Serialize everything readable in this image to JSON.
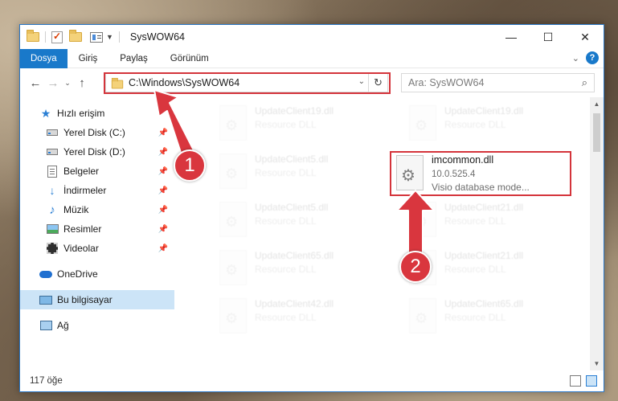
{
  "window": {
    "title": "SysWOW64",
    "controls": {
      "minimize": "—",
      "maximize": "☐",
      "close": "✕"
    }
  },
  "ribbon": {
    "tabs": [
      {
        "label": "Dosya",
        "active": true
      },
      {
        "label": "Giriş"
      },
      {
        "label": "Paylaş"
      },
      {
        "label": "Görünüm"
      }
    ],
    "help": "?"
  },
  "nav": {
    "back": "←",
    "forward": "→",
    "recent": "⌄",
    "up": "↑",
    "address": "C:\\Windows\\SysWOW64",
    "search_placeholder": "Ara: SysWOW64"
  },
  "sidebar": {
    "items": [
      {
        "label": "Hızlı erişim",
        "icon": "star-icon"
      },
      {
        "label": "Yerel Disk (C:)",
        "icon": "drive-icon",
        "pinned": true
      },
      {
        "label": "Yerel Disk (D:)",
        "icon": "drive-icon",
        "pinned": true
      },
      {
        "label": "Belgeler",
        "icon": "document-icon",
        "pinned": true
      },
      {
        "label": "İndirmeler",
        "icon": "download-icon",
        "pinned": true
      },
      {
        "label": "Müzik",
        "icon": "music-icon",
        "pinned": true
      },
      {
        "label": "Resimler",
        "icon": "pictures-icon",
        "pinned": true
      },
      {
        "label": "Videolar",
        "icon": "video-icon",
        "pinned": true
      },
      {
        "label": "OneDrive",
        "icon": "cloud-icon"
      },
      {
        "label": "Bu bilgisayar",
        "icon": "computer-icon",
        "selected": true
      },
      {
        "label": "Ağ",
        "icon": "network-icon"
      }
    ]
  },
  "files": [
    {
      "name": "UpdateClient19.dll",
      "sub": "Resource DLL"
    },
    {
      "name": "UpdateClient19.dll",
      "sub": "Resource DLL"
    },
    {
      "name": "UpdateClient5.dll",
      "sub": "Resource DLL"
    },
    {
      "name": "imcommon.dll",
      "version": "10.0.525.4",
      "sub": "Visio database mode..."
    },
    {
      "name": "UpdateClient5.dll",
      "sub": "Resource DLL"
    },
    {
      "name": "UpdateClient21.dll",
      "sub": "Resource DLL"
    },
    {
      "name": "UpdateClient65.dll",
      "sub": "Resource DLL"
    },
    {
      "name": "UpdateClient21.dll",
      "sub": "Resource DLL"
    },
    {
      "name": "UpdateClient42.dll",
      "sub": "Resource DLL"
    },
    {
      "name": "UpdateClient65.dll",
      "sub": "Resource DLL"
    }
  ],
  "status": {
    "count": "117 öğe"
  },
  "annotations": {
    "step1": "1",
    "step2": "2",
    "color": "#d9363e"
  }
}
